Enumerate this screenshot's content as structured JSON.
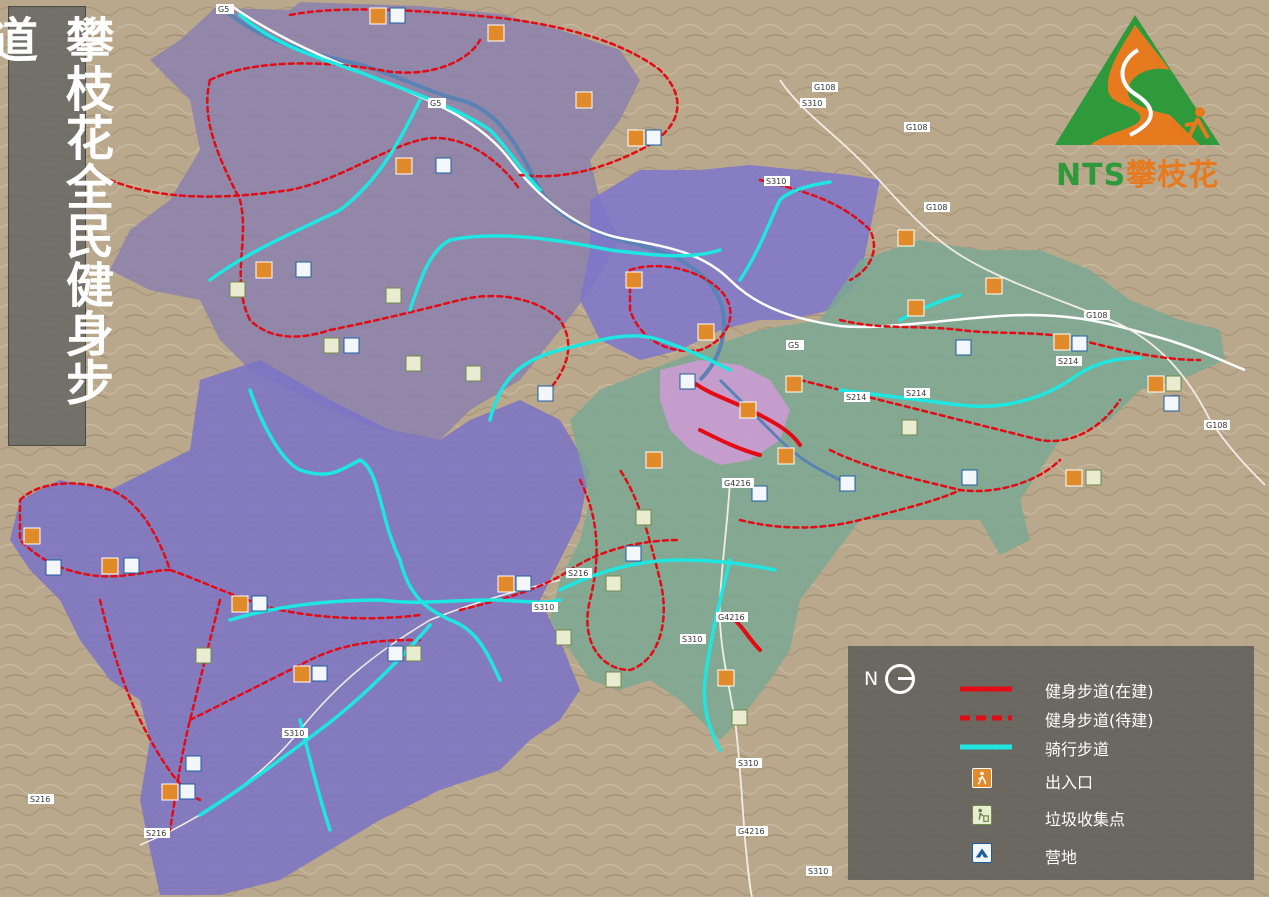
{
  "title": "攀枝花全民健身步道",
  "logo": {
    "brand": "NTS",
    "city": "攀枝花"
  },
  "compass": {
    "north_label": "N"
  },
  "legend": {
    "items": [
      {
        "key": "built",
        "label": "健身步道(在建)",
        "color": "#e30b14"
      },
      {
        "key": "planned",
        "label": "健身步道(待建)",
        "color": "#e30b14"
      },
      {
        "key": "cycling",
        "label": "骑行步道",
        "color": "#1ee6e0"
      },
      {
        "key": "entrance",
        "label": "出入口",
        "icon": "hiker-icon",
        "color": "#e08a2a"
      },
      {
        "key": "trash",
        "label": "垃圾收集点",
        "icon": "trash-bin-icon",
        "color": "#e9ecd1"
      },
      {
        "key": "camp",
        "label": "营地",
        "icon": "tent-icon",
        "color": "#1c5d9e"
      }
    ]
  },
  "roads": [
    {
      "id": "G5",
      "label": "G5"
    },
    {
      "id": "G108",
      "label": "G108"
    },
    {
      "id": "S310",
      "label": "S310"
    },
    {
      "id": "S214",
      "label": "S214"
    },
    {
      "id": "S216",
      "label": "S216"
    },
    {
      "id": "G4216",
      "label": "G4216"
    }
  ],
  "colors": {
    "terrain": "#b9a88c",
    "zone_west": "#8a7fb0",
    "zone_southwest": "#7a73c8",
    "zone_east": "#7aa893",
    "zone_center": "#cf9bd6"
  }
}
